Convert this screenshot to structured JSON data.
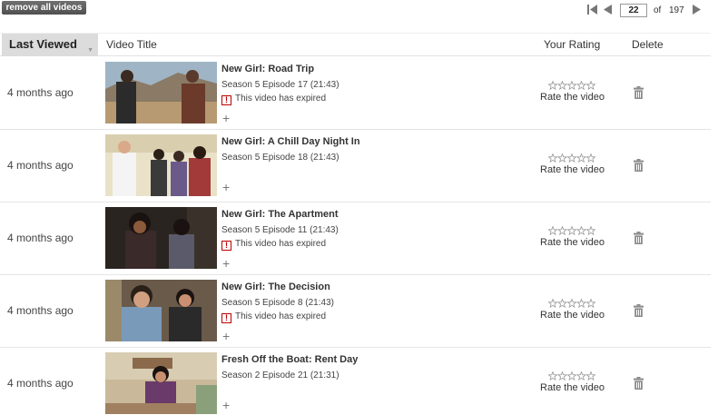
{
  "toolbar": {
    "remove_all_label": "remove all videos"
  },
  "pager": {
    "current": "22",
    "of_label": "of",
    "total": "197"
  },
  "table": {
    "headers": {
      "last_viewed": "Last Viewed",
      "video_title": "Video Title",
      "your_rating": "Your Rating",
      "delete": "Delete"
    }
  },
  "rows": [
    {
      "viewed": "4 months ago",
      "title": "New Girl: Road Trip",
      "episode": "Season 5  Episode 17 (21:43)",
      "expired_text": "This video has expired",
      "rate_label": "Rate the video"
    },
    {
      "viewed": "4 months ago",
      "title": "New Girl: A Chill Day Night In",
      "episode": "Season 5  Episode 18 (21:43)",
      "expired_text": "",
      "rate_label": "Rate the video"
    },
    {
      "viewed": "4 months ago",
      "title": "New Girl: The Apartment",
      "episode": "Season 5  Episode 11 (21:43)",
      "expired_text": "This video has expired",
      "rate_label": "Rate the video"
    },
    {
      "viewed": "4 months ago",
      "title": "New Girl: The Decision",
      "episode": "Season 5  Episode 8 (21:43)",
      "expired_text": "This video has expired",
      "rate_label": "Rate the video"
    },
    {
      "viewed": "4 months ago",
      "title": "Fresh Off the Boat: Rent Day",
      "episode": "Season 2  Episode 21 (21:31)",
      "expired_text": "",
      "rate_label": "Rate the video"
    }
  ],
  "colors": {
    "expired_icon": "#bb0000",
    "header_sorted_bg": "#dcdcdc",
    "remove_button_bg": "#5a5a5a"
  },
  "icons": {
    "first_page": "first-page-icon",
    "prev_page": "prev-page-icon",
    "next_page": "next-page-icon",
    "delete": "trash-icon",
    "add": "plus-icon",
    "expired": "exclamation-icon",
    "rating": "empty-star-icon"
  }
}
